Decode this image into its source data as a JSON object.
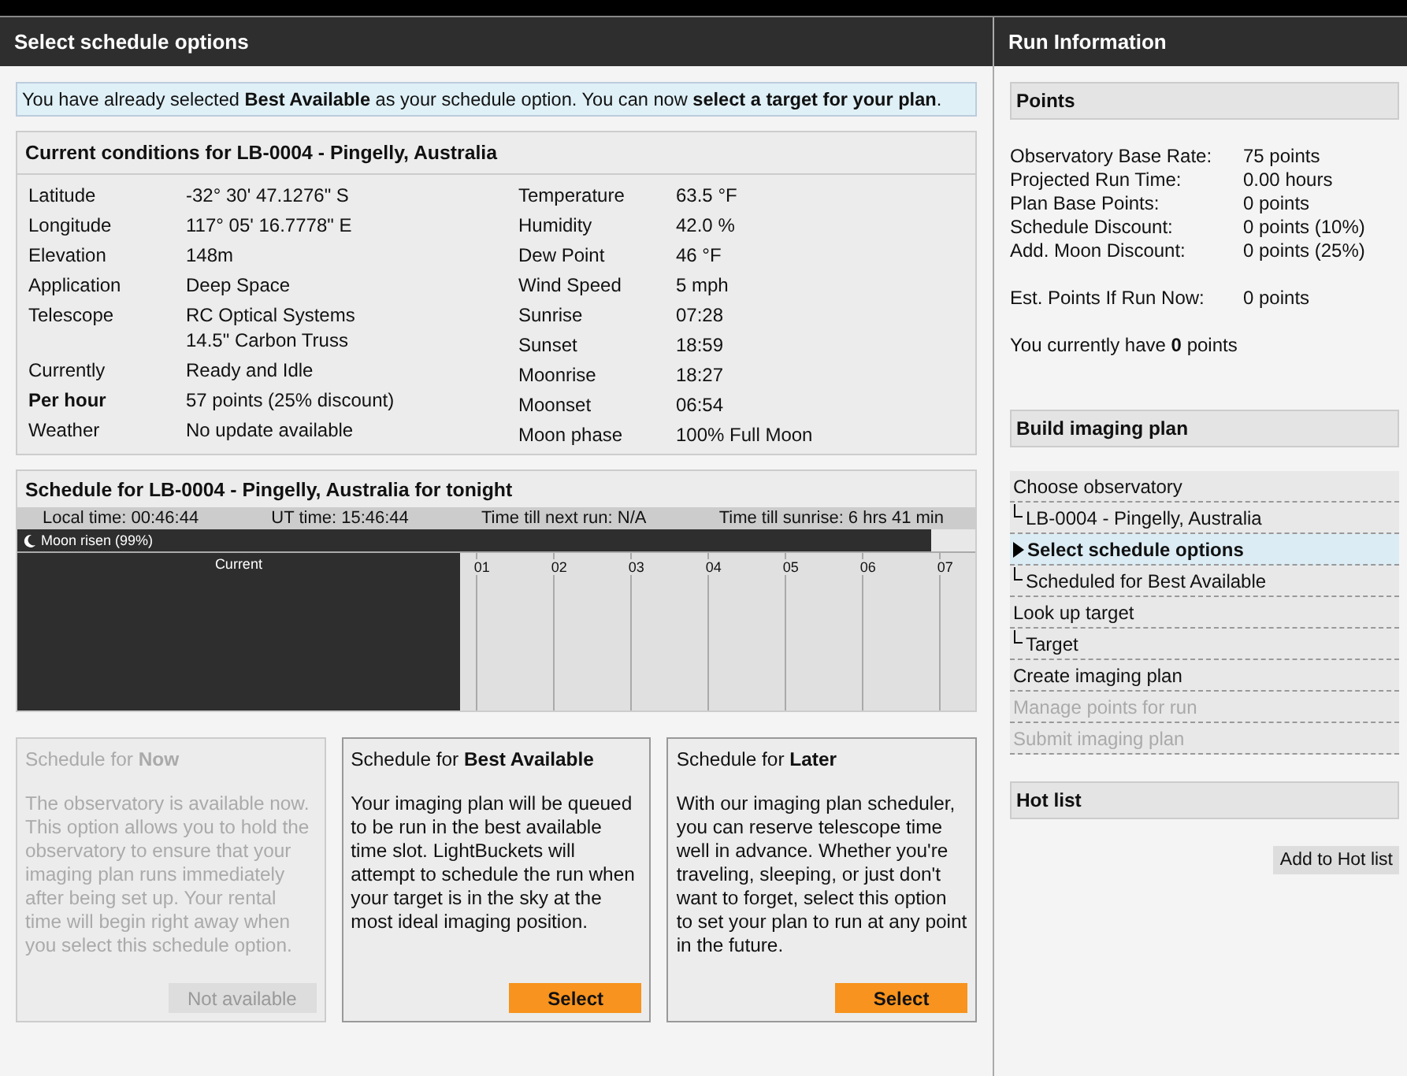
{
  "main": {
    "title": "Select schedule options",
    "notice": "You have already selected **Best Available** as your schedule option. You can now **select a target for your plan**.",
    "conditions": {
      "title": "Current conditions for LB-0004 - Pingelly, Australia",
      "left": [
        {
          "label": "Latitude",
          "value": "-32° 30' 47.1276\" S",
          "bold": false
        },
        {
          "label": "Longitude",
          "value": "117° 05' 16.7778\" E",
          "bold": false
        },
        {
          "label": "Elevation",
          "value": "148m",
          "bold": false
        },
        {
          "label": "Application",
          "value": "Deep Space",
          "bold": false
        },
        {
          "label": "Telescope",
          "value": "RC Optical Systems\n14.5\" Carbon Truss",
          "bold": false
        },
        {
          "label": "Currently",
          "value": "Ready and Idle",
          "bold": false
        },
        {
          "label": "Per hour",
          "value": "57 points (25% discount)",
          "bold": true
        },
        {
          "label": "Weather",
          "value": "No update available",
          "bold": false
        }
      ],
      "right": [
        {
          "label": "Temperature",
          "value": "63.5 °F"
        },
        {
          "label": "Humidity",
          "value": "42.0 %"
        },
        {
          "label": "Dew Point",
          "value": "46 °F"
        },
        {
          "label": "Wind Speed",
          "value": "5 mph"
        },
        {
          "label": "Sunrise",
          "value": "07:28"
        },
        {
          "label": "Sunset",
          "value": "18:59"
        },
        {
          "label": "Moonrise",
          "value": "18:27"
        },
        {
          "label": "Moonset",
          "value": "06:54"
        },
        {
          "label": "Moon phase",
          "value": "100% Full Moon"
        }
      ]
    },
    "schedule": {
      "title": "Schedule for LB-0004 - Pingelly, Australia for tonight",
      "times": [
        "Local time: 00:46:44",
        "UT time: 15:46:44",
        "Time till next run: N/A",
        "Time till sunrise: 6 hrs 41 min"
      ],
      "moon": {
        "label": "Moon risen (99%)",
        "level": 0.954
      },
      "current": {
        "label": "Current",
        "level": 0.462
      },
      "hours": [
        "01",
        "02",
        "03",
        "04",
        "05",
        "06",
        "07"
      ]
    },
    "options": [
      {
        "title": "Schedule for **Now**",
        "text": "The observatory is available now. This option allows you to hold the observatory to ensure that your imaging plan runs immediately after being set up. Your rental time will begin right away when you select this schedule option.",
        "button": "Not available",
        "disabled": true
      },
      {
        "title": "Schedule for **Best Available**",
        "text": "Your imaging plan will be queued to be run in the best available time slot. LightBuckets will attempt to schedule the run when your target is in the sky at the most ideal imaging position.",
        "button": "Select",
        "disabled": false
      },
      {
        "title": "Schedule for **Later**",
        "text": "With our imaging plan scheduler, you can reserve telescope time well in advance. Whether you're traveling, sleeping, or just don't want to forget, select this option to set your plan to run at any point in the future.",
        "button": "Select",
        "disabled": false
      }
    ]
  },
  "sidebar": {
    "title": "Run Information",
    "points": {
      "title": "Points",
      "rows": [
        {
          "label": "Observatory Base Rate:",
          "value": "75 points"
        },
        {
          "label": "Projected Run Time:",
          "value": "0.00 hours"
        },
        {
          "label": "Plan Base Points:",
          "value": "0 points"
        },
        {
          "label": "Schedule Discount:",
          "value": "0 points (10%)"
        },
        {
          "label": "Add. Moon Discount:",
          "value": "0 points (25%)"
        }
      ],
      "estimate": {
        "label": "Est. Points If Run Now:",
        "value": "0 points"
      },
      "balance": "You currently have **0** points"
    },
    "plan": {
      "title": "Build imaging plan",
      "steps": [
        {
          "kind": "step",
          "label": "Choose observatory",
          "selected": false,
          "disabled": false
        },
        {
          "kind": "sub",
          "label": "LB-0004 - Pingelly, Australia",
          "selected": false,
          "disabled": false
        },
        {
          "kind": "step",
          "label": "Select schedule options",
          "selected": true,
          "disabled": false
        },
        {
          "kind": "sub",
          "label": "Scheduled for Best Available",
          "selected": false,
          "disabled": false
        },
        {
          "kind": "step",
          "label": "Look up target",
          "selected": false,
          "disabled": false
        },
        {
          "kind": "sub",
          "label": "Target",
          "selected": false,
          "disabled": false
        },
        {
          "kind": "step",
          "label": "Create imaging plan",
          "selected": false,
          "disabled": false
        },
        {
          "kind": "step",
          "label": "Manage points for run",
          "selected": false,
          "disabled": true
        },
        {
          "kind": "step",
          "label": "Submit imaging plan",
          "selected": false,
          "disabled": true
        }
      ]
    },
    "hotlist": {
      "title": "Hot list",
      "button": "Add to Hot list"
    }
  }
}
